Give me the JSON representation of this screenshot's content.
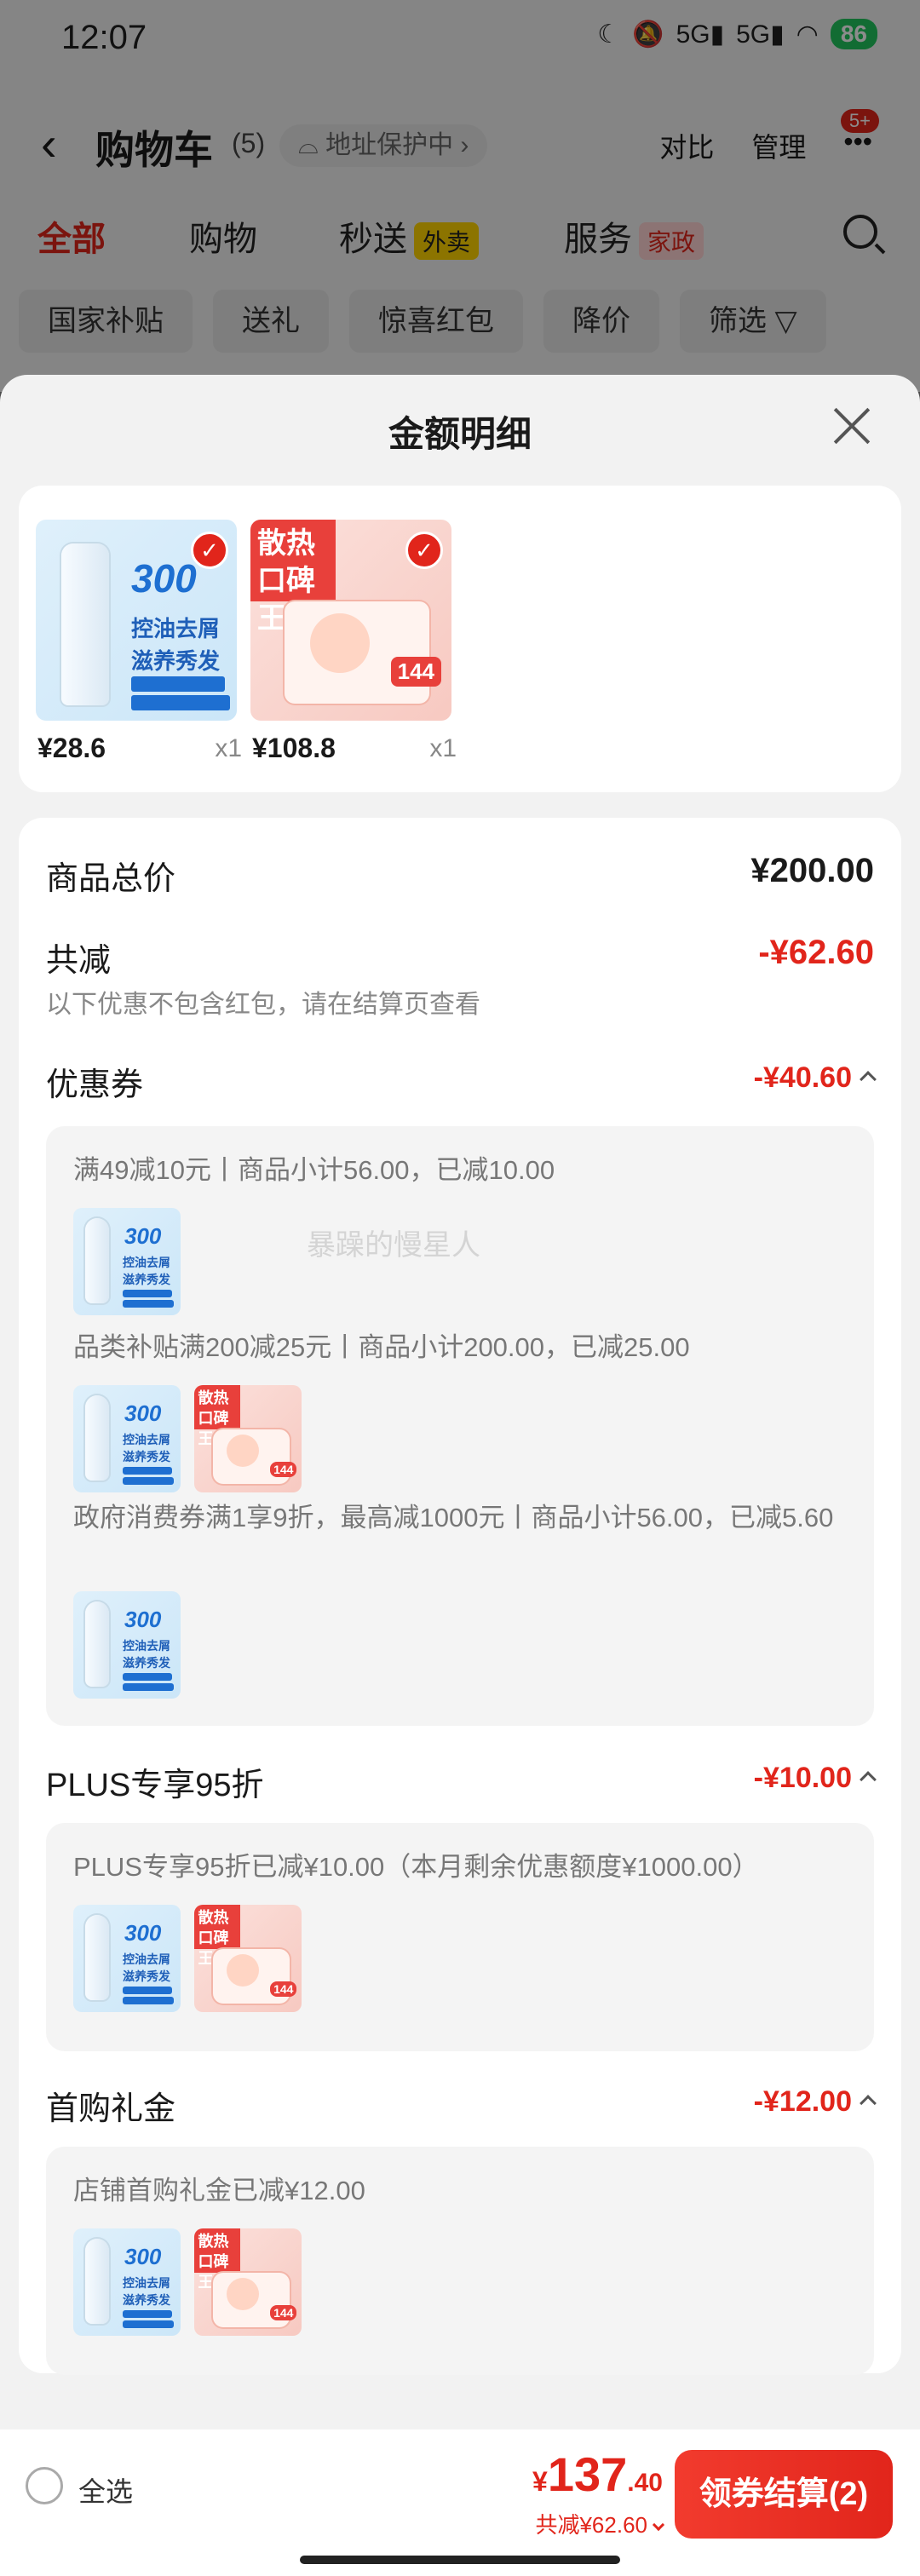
{
  "status": {
    "time": "12:07",
    "signal1": "5G",
    "signal2": "5G",
    "battery": "86"
  },
  "nav": {
    "title": "购物车",
    "count": "(5)",
    "addr_label": "地址保护中",
    "compare": "对比",
    "manage": "管理",
    "more_badge": "5+"
  },
  "tabs": [
    {
      "label": "全部"
    },
    {
      "label": "购物"
    },
    {
      "label": "秒送",
      "tag": "外卖"
    },
    {
      "label": "服务",
      "tag": "家政"
    }
  ],
  "chips": [
    "国家补贴",
    "送礼",
    "惊喜红包",
    "降价",
    "筛选"
  ],
  "sheet": {
    "title": "金额明细"
  },
  "products": [
    {
      "price": "¥28.6",
      "qty": "x1",
      "art": {
        "big": "300",
        "l1": "控油去屑",
        "l2": "滋养秀发"
      }
    },
    {
      "price": "¥108.8",
      "qty": "x1",
      "art": {
        "hd": "散热口碑王",
        "tag": "144"
      }
    }
  ],
  "summary": {
    "total_label": "商品总价",
    "total_value": "¥200.00",
    "reduce_label": "共减",
    "reduce_value": "-¥62.60",
    "note": "以下优惠不包含红包，请在结算页查看"
  },
  "groups": {
    "coupon": {
      "label": "优惠券",
      "amount": "-¥40.60",
      "lines": [
        "满49减10元丨商品小计56.00，已减10.00",
        "品类补贴满200减25元丨商品小计200.00，已减25.00",
        "政府消费券满1享9折，最高减1000元丨商品小计56.00，已减5.60"
      ]
    },
    "plus": {
      "label": "PLUS专享95折",
      "amount": "-¥10.00",
      "lines": [
        "PLUS专享95折已减¥10.00（本月剩余优惠额度¥1000.00）"
      ]
    },
    "first": {
      "label": "首购礼金",
      "amount": "-¥12.00",
      "lines": [
        "店铺首购礼金已减¥12.00"
      ]
    }
  },
  "watermark": "暴躁的慢星人",
  "bottom": {
    "select_all": "全选",
    "currency": "¥",
    "total_int": "137",
    "total_dec": ".40",
    "total_reduce": "共减¥62.60",
    "checkout": "领券结算(2)"
  },
  "colors": {
    "accent": "#e1251b",
    "battery": "#22c55e"
  }
}
